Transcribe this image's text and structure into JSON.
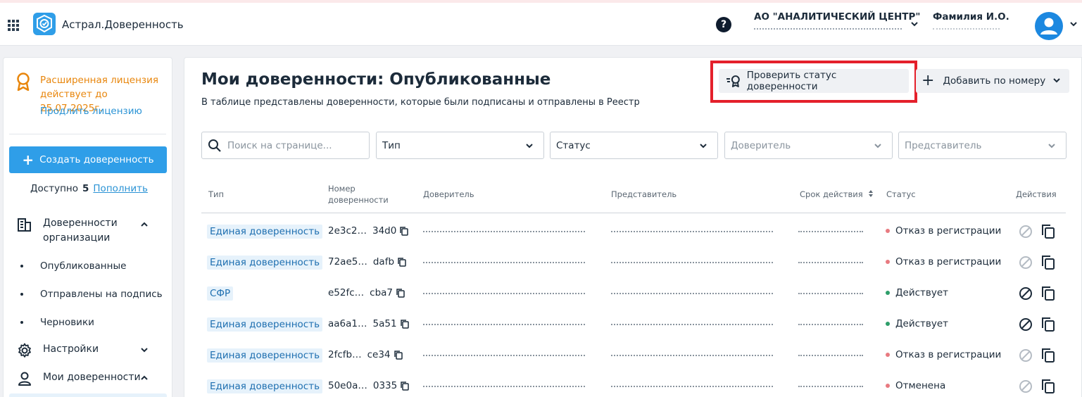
{
  "header": {
    "brand": "Астрал.Доверенность",
    "help": "?",
    "org_name": "АО \"АНАЛИТИЧЕСКИЙ ЦЕНТР\"",
    "user_name": "Фамилия И.О."
  },
  "sidebar": {
    "license_text_1": "Расширенная лицензия",
    "license_text_2": "действует до 25.07.2025г.",
    "license_link": "Продлить лицензию",
    "create_button": "Создать доверенность",
    "available_label": "Доступно",
    "available_count": "5",
    "replenish_link": "Пополнить",
    "nav": {
      "org_line1": "Доверенности",
      "org_line2": "организации",
      "sub_published": "Опубликованные",
      "sub_sent": "Отправлены на подпись",
      "sub_drafts": "Черновики",
      "settings": "Настройки",
      "my": "Мои доверенности"
    }
  },
  "main": {
    "title": "Мои доверенности: Опубликованные",
    "subtitle": "В таблице представлены доверенности, которые были подписаны и отправлены в Реестр",
    "check_status_button": "Проверить статус доверенности",
    "add_by_number_button": "Добавить по номеру",
    "filters": {
      "search_placeholder": "Поиск на странице...",
      "type": "Тип",
      "status": "Статус",
      "principal": "Доверитель",
      "representative": "Представитель"
    },
    "columns": {
      "type": "Тип",
      "number_1": "Номер",
      "number_2": "доверенности",
      "principal": "Доверитель",
      "representative": "Представитель",
      "validity": "Срок действия",
      "status": "Статус",
      "actions": "Действия"
    },
    "rows": [
      {
        "type": "Единая доверенность",
        "num_a": "2e3c2…",
        "num_b": "34d0",
        "status": "Отказ в регистрации",
        "status_color": "#e87a80",
        "active": false
      },
      {
        "type": "Единая доверенность",
        "num_a": "72ae5…",
        "num_b": "dafb",
        "status": "Отказ в регистрации",
        "status_color": "#e87a80",
        "active": false
      },
      {
        "type": "СФР",
        "num_a": "e52fc…",
        "num_b": "cba7",
        "status": "Действует",
        "status_color": "#2e9e6a",
        "active": true
      },
      {
        "type": "Единая доверенность",
        "num_a": "aa6a1…",
        "num_b": "5a51",
        "status": "Действует",
        "status_color": "#2e9e6a",
        "active": true
      },
      {
        "type": "Единая доверенность",
        "num_a": "2fcfb…",
        "num_b": "ce34",
        "status": "Отказ в регистрации",
        "status_color": "#e87a80",
        "active": false
      },
      {
        "type": "Единая доверенность",
        "num_a": "50e0a…",
        "num_b": "0335",
        "status": "Отменена",
        "status_color": "#e87a80",
        "active": false
      }
    ]
  },
  "colors": {
    "accent": "#2f9ee8",
    "license": "#e8860c",
    "highlight": "#e4202b",
    "error": "#e87a80",
    "ok": "#2e9e6a"
  },
  "icons": [
    "apps-grid-icon",
    "logo-icon",
    "help-icon",
    "chevron-down-icon",
    "avatar-icon",
    "award-icon",
    "plus-icon",
    "building-icon",
    "gear-icon",
    "person-icon",
    "search-icon",
    "copy-icon",
    "cancel-icon",
    "sort-icon"
  ]
}
